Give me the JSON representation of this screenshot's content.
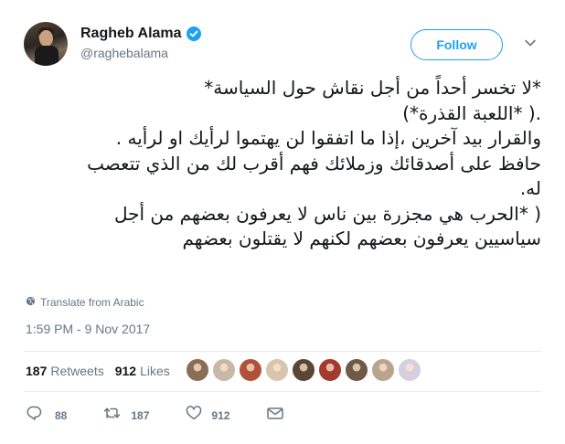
{
  "user": {
    "display_name": "Ragheb Alama",
    "handle": "@raghebalama",
    "verified": true
  },
  "follow_label": "Follow",
  "tweet_lines": [
    "*لا تخسر أحداً من أجل نقاش حول السياسة*",
    ".( *اللعبة القذرة*)",
    "والقرار بيد آخرين ،إذا ما اتفقوا لن يهتموا لرأيك او لرأيه .",
    " حافظ على أصدقائك وزملائك  فهم أقرب لك من الذي تتعصب",
    "له.",
    "( *الحرب هي مجزرة بين ناس لا يعرفون بعضهم من أجل",
    "سياسيين يعرفون بعضهم  لكنهم لا يقتلون بعضهم"
  ],
  "translate_label": "Translate from Arabic",
  "timestamp": "1:59 PM - 9 Nov 2017",
  "stats": {
    "retweets_count": "187",
    "retweets_label": "Retweets",
    "likes_count": "912",
    "likes_label": "Likes"
  },
  "liker_colors": [
    "#8a6d55",
    "#c8b8a6",
    "#b0523a",
    "#d9c4b0",
    "#5b4636",
    "#a33a2e",
    "#6f5a48",
    "#b9a48e",
    "#d6cfe0"
  ],
  "actions": {
    "replies": "88",
    "retweets": "187",
    "likes": "912"
  },
  "colors": {
    "accent": "#1da1f2",
    "text": "#14171a",
    "secondary": "#657786",
    "divider": "#e6ecf0"
  }
}
